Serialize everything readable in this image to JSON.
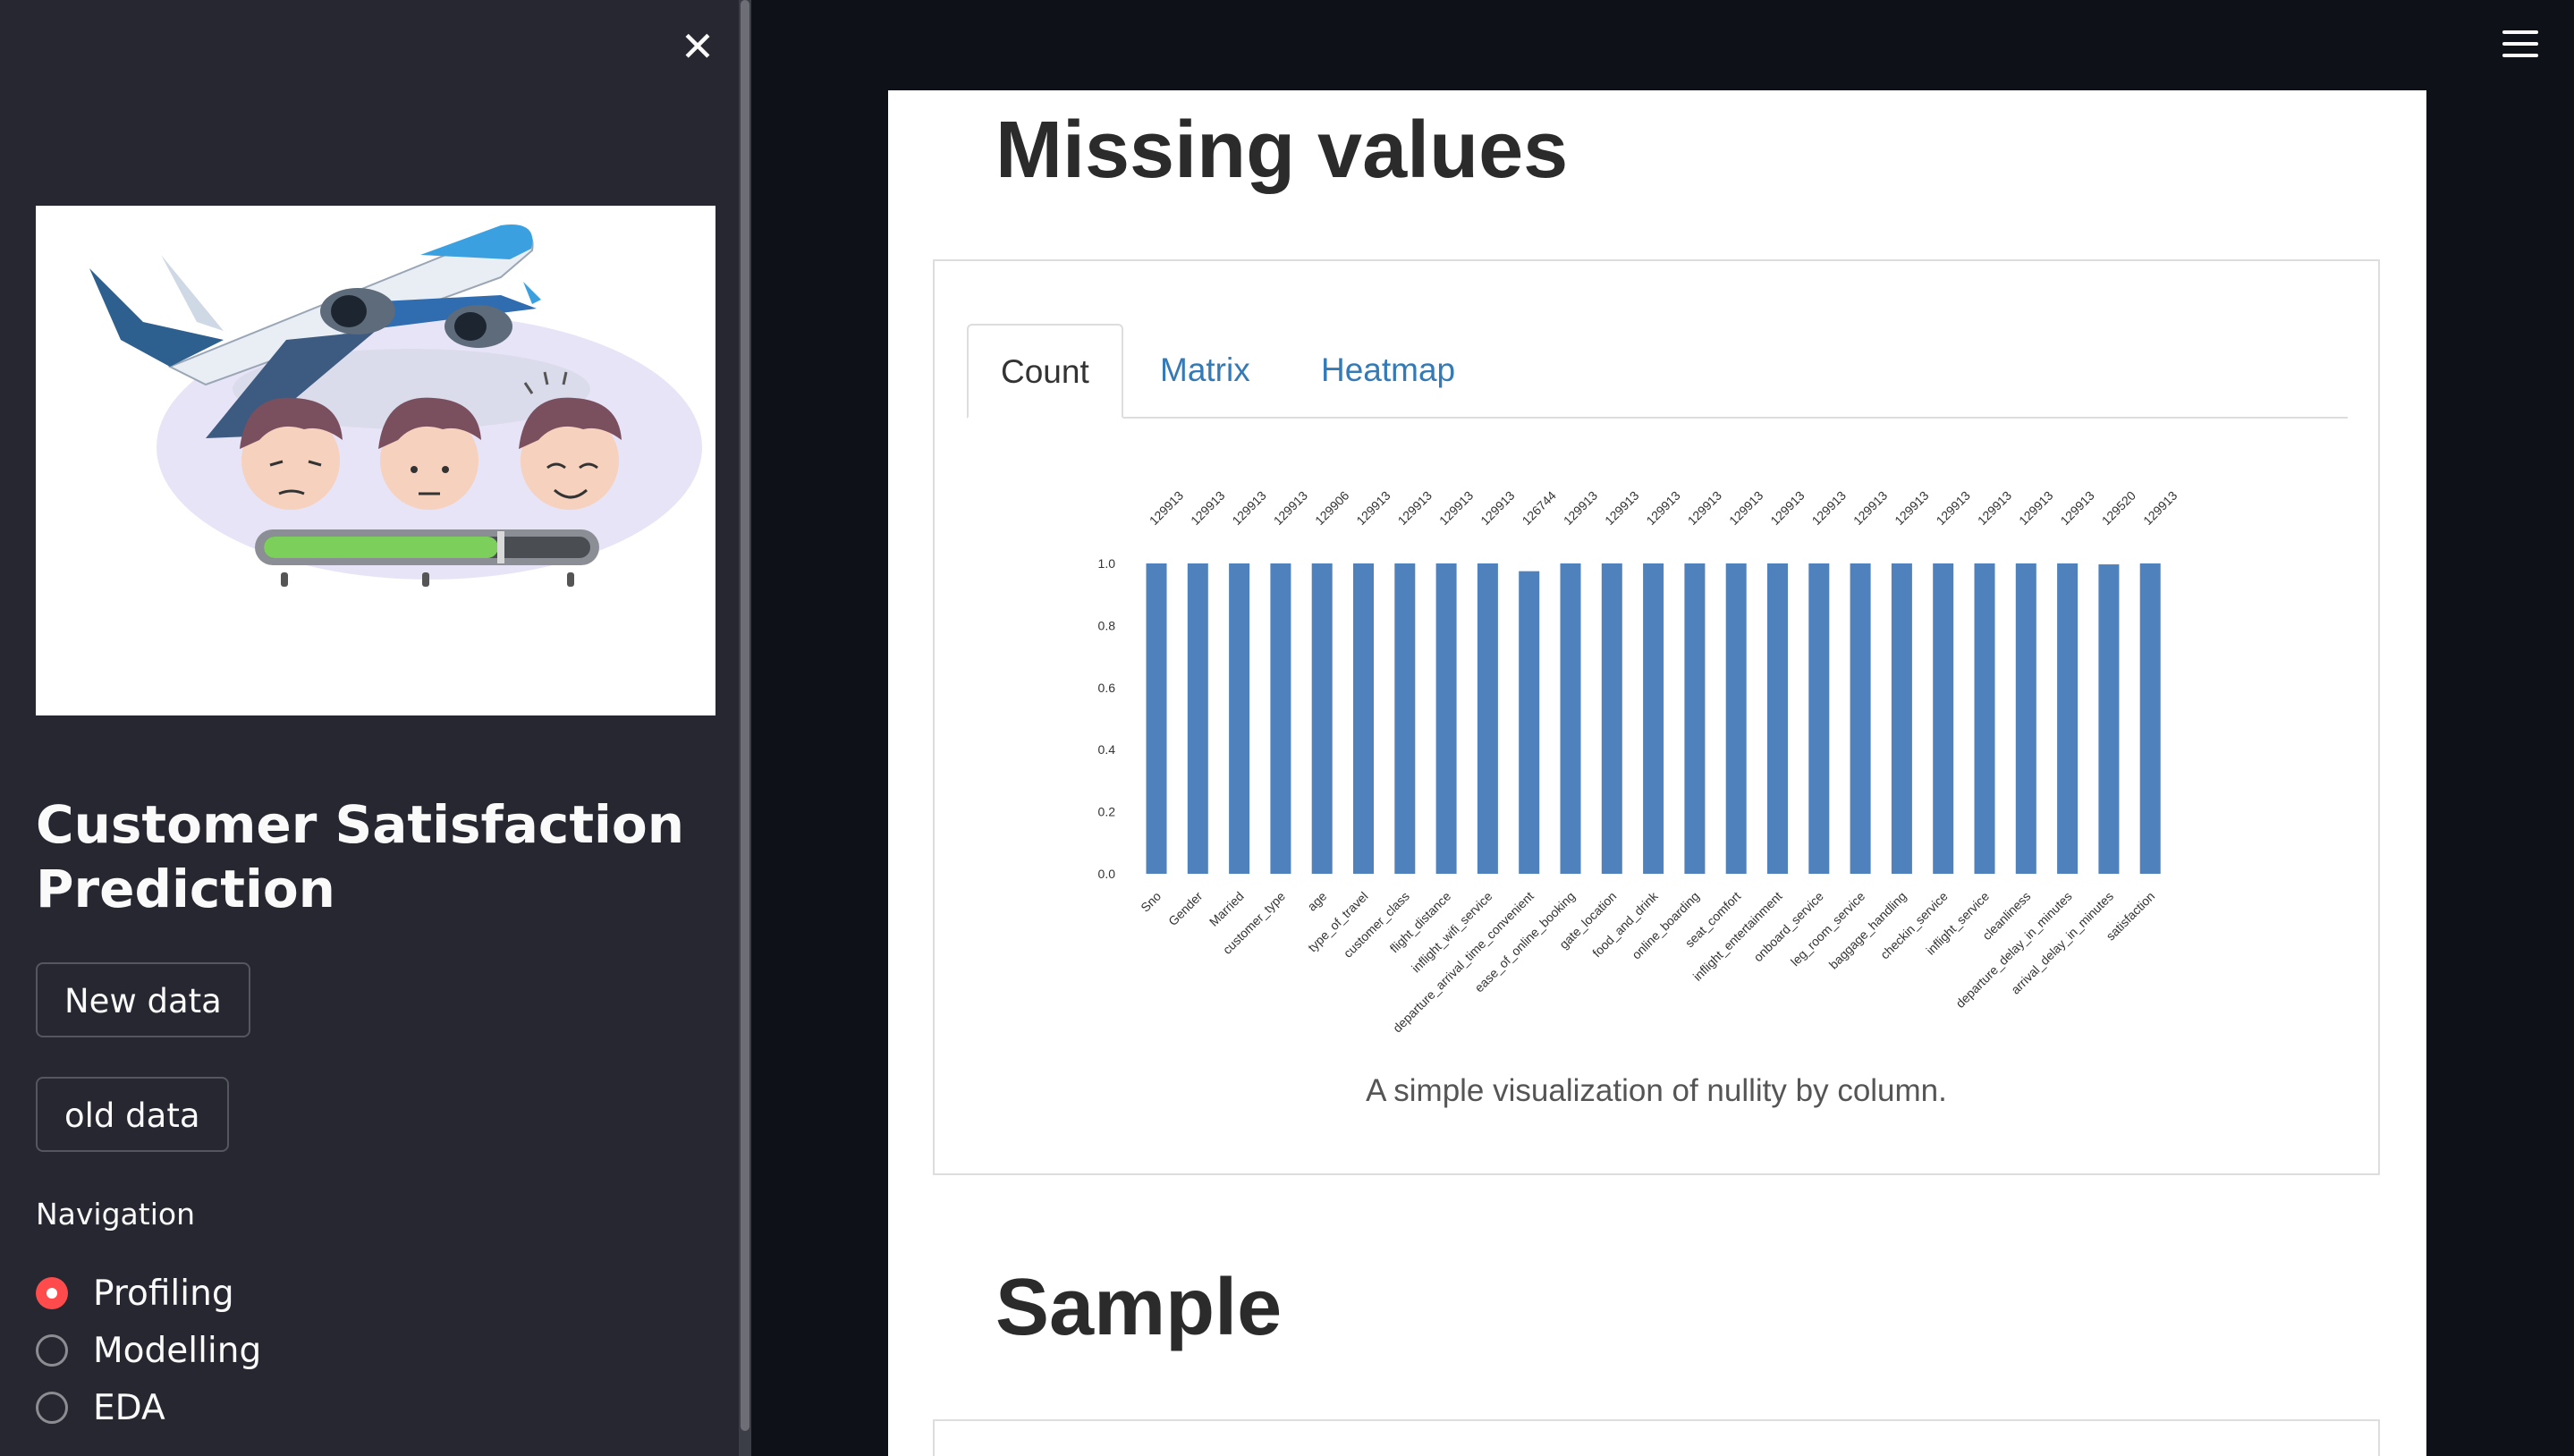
{
  "sidebar": {
    "close_icon": "close-icon",
    "hero_image": "airplane-satisfaction-illustration",
    "title": "Customer Satisfaction Prediction",
    "buttons": {
      "new_data": "New data",
      "old_data": "old data"
    },
    "nav_label": "Navigation",
    "nav_options": [
      {
        "label": "Profiling",
        "selected": true
      },
      {
        "label": "Modelling",
        "selected": false
      },
      {
        "label": "EDA",
        "selected": false
      }
    ],
    "accent_color": "#ff4b4b"
  },
  "header": {
    "menu_icon": "hamburger-menu-icon"
  },
  "main": {
    "missing_title": "Missing values",
    "tabs": [
      {
        "label": "Count",
        "active": true
      },
      {
        "label": "Matrix",
        "active": false
      },
      {
        "label": "Heatmap",
        "active": false
      }
    ],
    "caption": "A simple visualization of nullity by column.",
    "sample_title": "Sample"
  },
  "chart_data": {
    "type": "bar",
    "color": "#4f81bd",
    "ylim": [
      0,
      1
    ],
    "yticks": [
      "0.0",
      "0.2",
      "0.4",
      "0.6",
      "0.8",
      "1.0"
    ],
    "categories": [
      "Sno",
      "Gender",
      "Married",
      "customer_type",
      "age",
      "type_of_travel",
      "customer_class",
      "flight_distance",
      "inflight_wifi_service",
      "departure_arrival_time_convenient",
      "ease_of_online_booking",
      "gate_location",
      "food_and_drink",
      "online_boarding",
      "seat_comfort",
      "inflight_entertainment",
      "onboard_service",
      "leg_room_service",
      "baggage_handling",
      "checkin_service",
      "inflight_service",
      "cleanliness",
      "departure_delay_in_minutes",
      "arrival_delay_in_minutes",
      "satisfaction"
    ],
    "values": [
      1.0,
      1.0,
      1.0,
      1.0,
      1.0,
      1.0,
      1.0,
      1.0,
      1.0,
      0.975,
      1.0,
      1.0,
      1.0,
      1.0,
      1.0,
      1.0,
      1.0,
      1.0,
      1.0,
      1.0,
      1.0,
      1.0,
      1.0,
      0.997,
      1.0
    ],
    "counts": [
      "129913",
      "129913",
      "129913",
      "129913",
      "129906",
      "129913",
      "129913",
      "129913",
      "129913",
      "126744",
      "129913",
      "129913",
      "129913",
      "129913",
      "129913",
      "129913",
      "129913",
      "129913",
      "129913",
      "129913",
      "129913",
      "129913",
      "129913",
      "129520",
      "129913"
    ]
  }
}
